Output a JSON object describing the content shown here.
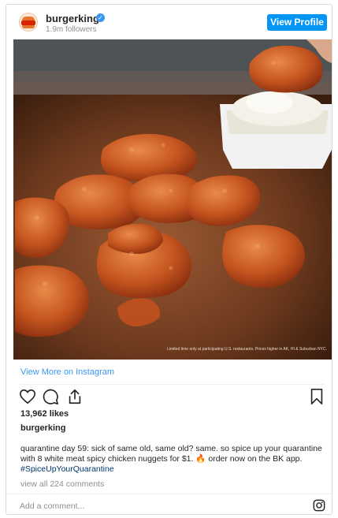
{
  "header": {
    "username": "burgerking",
    "followers": "1.9m followers",
    "view_profile": "View Profile",
    "avatar_icon": "burger-king-logo",
    "verified_icon": "verified-badge-icon",
    "verified_glyph": "✓"
  },
  "photo": {
    "fine_print": "Limited time only at participating U.S. restaurants. Prices higher in AK, HI & Suburban NYC."
  },
  "view_more": "View More on Instagram",
  "actions": {
    "like_icon": "heart-icon",
    "comment_icon": "comment-icon",
    "share_icon": "share-icon",
    "save_icon": "bookmark-icon"
  },
  "likes": "13,962 likes",
  "owner": "burgerking",
  "caption": {
    "text": "quarantine day 59: sick of same old, same old? same.  so spice up your quarantine with 8 white meat spicy chicken nuggets for $1. 🔥 order now on the BK app.",
    "hashtag": "#SpiceUpYourQuarantine"
  },
  "comments": "view all 224 comments",
  "add_comment_placeholder": "Add a comment...",
  "instagram_icon": "instagram-icon",
  "colors": {
    "accent": "#0095f6",
    "link": "#3897f0",
    "muted": "#8e8e8e",
    "text": "#262626"
  }
}
